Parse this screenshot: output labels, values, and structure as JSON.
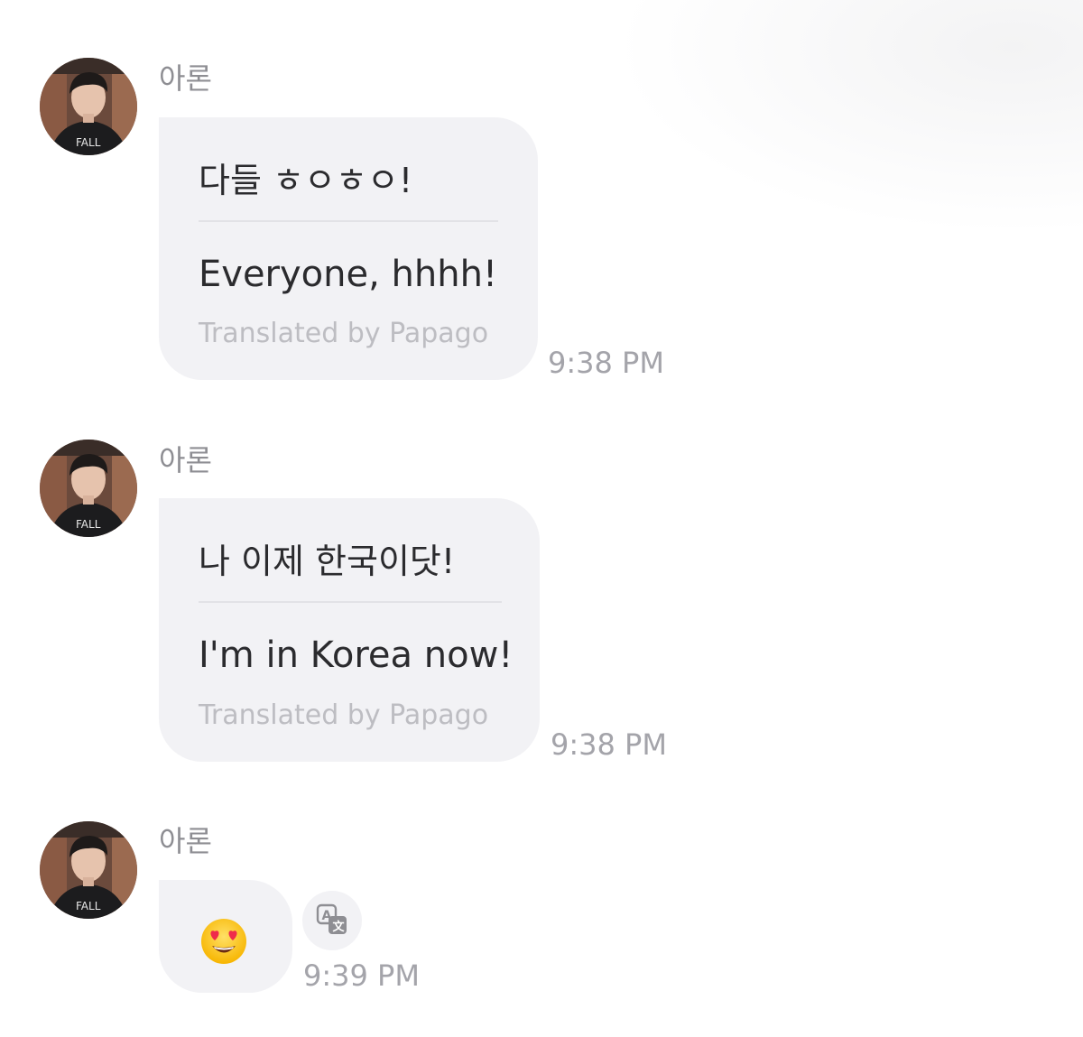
{
  "messages": [
    {
      "sender": "아론",
      "original": "다들 ㅎㅇㅎㅇ!",
      "translated": "Everyone, hhhh!",
      "credit": "Translated by Papago",
      "time": "9:38 PM"
    },
    {
      "sender": "아론",
      "original": "나 이제 한국이닷!",
      "translated": "I'm in Korea now!",
      "credit": "Translated by Papago",
      "time": "9:38 PM"
    },
    {
      "sender": "아론",
      "emoji": "heart-eyes-emoji",
      "time": "9:39 PM"
    }
  ],
  "icons": {
    "translate": "translate-icon"
  },
  "colors": {
    "bubble": "#f2f2f5",
    "meta_text": "#8e8e93",
    "message_text": "#2b2b2e",
    "credit_text": "#bdbdc2"
  }
}
